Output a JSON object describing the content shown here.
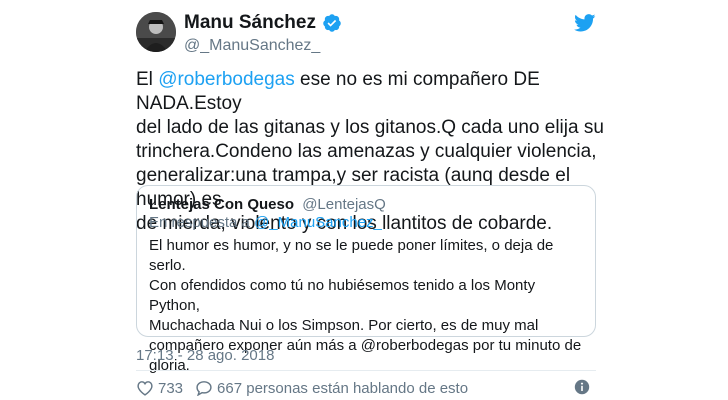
{
  "user": {
    "name": "Manu Sánchez",
    "handle": "@_ManuSanchez_"
  },
  "tweet": {
    "text_before_mention": "El ",
    "mention": "@roberbodegas",
    "text_after_mention": " ese no es mi compañero DE NADA.Estoy\ndel lado de las gitanas y los gitanos.Q cada uno elija su\ntrinchera.Condeno las amenazas y cualquier violencia,\ngeneralizar:una trampa,y ser racista (aunq desde el humor) es\nde mierda, violento y con los llantitos de cobarde."
  },
  "quoted": {
    "name": "Lentejas Con Queso",
    "handle": "@LentejasQ",
    "reply_prefix": "En respuesta a ",
    "reply_to": "@_ManuSanchez_",
    "text": "El humor es humor, y no se le puede poner límites, o deja de serlo.\nCon ofendidos como tú no hubiésemos tenido a los Monty Python,\nMuchachada Nui o los Simpson. Por cierto, es de muy mal\ncompañero exponer aún más a @roberbodegas por tu minuto de\ngloria."
  },
  "timestamp": "17:13 - 28 ago. 2018",
  "actions": {
    "likes": "733",
    "replies_text": "667 personas están hablando de esto"
  },
  "colors": {
    "accent": "#1da1f2",
    "text": "#14171a",
    "secondary": "#657786",
    "border": "#ccd6dd"
  },
  "icons": {
    "avatar": "user-avatar",
    "verified": "verified-badge-icon",
    "brand": "twitter-bird-icon",
    "like": "heart-icon",
    "reply": "speech-bubble-icon",
    "info": "info-icon"
  }
}
